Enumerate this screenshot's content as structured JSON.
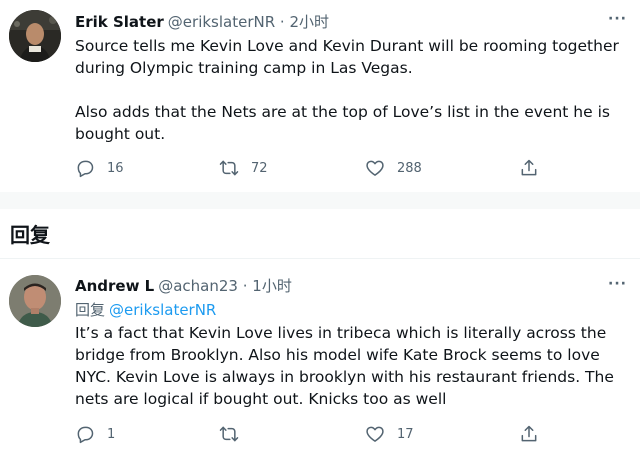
{
  "tweets": [
    {
      "author_name": "Erik Slater",
      "meta": "@erikslaterNR · 2小时",
      "paragraphs": [
        "Source tells me Kevin Love and Kevin Durant will be rooming together during Olympic training camp in Las Vegas.",
        "Also adds that the Nets are at the top of Love’s list in the event he is bought out."
      ],
      "reply_count": "16",
      "retweet_count": "72",
      "like_count": "288"
    },
    {
      "author_name": "Andrew L",
      "meta": "@achan23 · 1小时",
      "reply_prefix": "回复",
      "reply_handle": "@erikslaterNR",
      "paragraphs": [
        "It’s a fact that Kevin Love lives in tribeca which is literally across the bridge from Brooklyn. Also his model wife Kate Brock seems to love NYC.   Kevin Love is always in brooklyn with his restaurant friends. The nets are logical if bought out. Knicks too as well"
      ],
      "reply_count": "1",
      "retweet_count": "",
      "like_count": "17"
    }
  ],
  "section_title": "回复",
  "icons": {
    "more": "more-dots-icon",
    "reply": "reply-bubble-icon",
    "retweet": "retweet-icon",
    "like": "heart-icon",
    "share": "share-icon"
  },
  "colors": {
    "text": "#0f1419",
    "muted": "#536471",
    "link": "#1d9bf0",
    "separator": "#f7f9f9"
  }
}
